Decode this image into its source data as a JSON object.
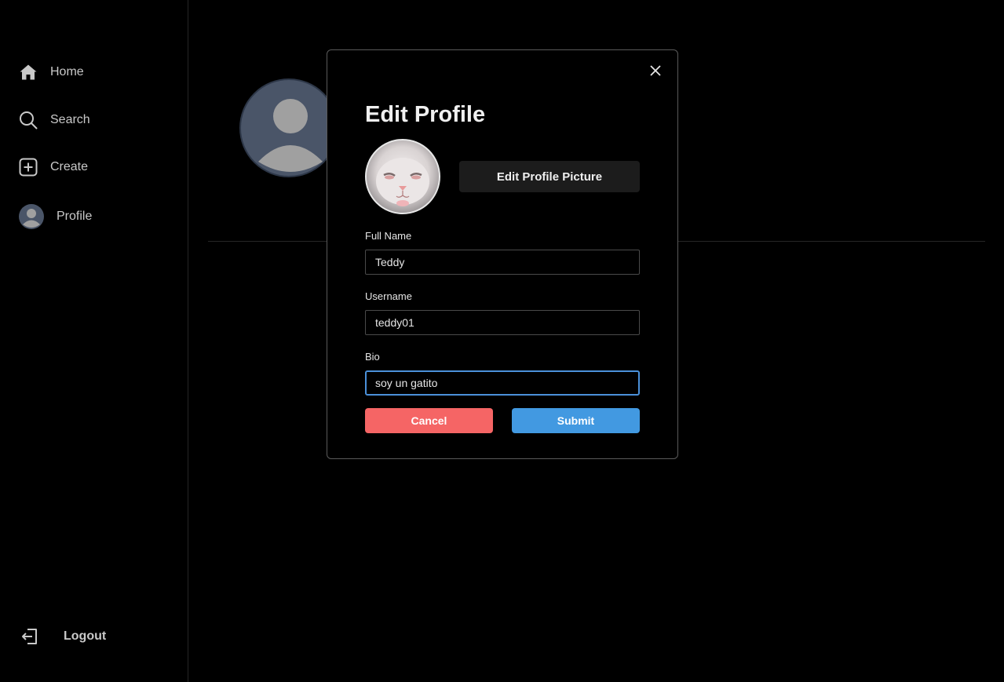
{
  "sidebar": {
    "items": [
      {
        "label": "Home",
        "icon": "home-icon"
      },
      {
        "label": "Search",
        "icon": "search-icon"
      },
      {
        "label": "Create",
        "icon": "plus-square-icon"
      },
      {
        "label": "Profile",
        "icon": "avatar"
      }
    ],
    "logout": {
      "label": "Logout",
      "icon": "logout-icon"
    }
  },
  "modal": {
    "title": "Edit Profile",
    "edit_picture_label": "Edit Profile Picture",
    "fields": {
      "full_name": {
        "label": "Full Name",
        "value": "Teddy"
      },
      "username": {
        "label": "Username",
        "value": "teddy01"
      },
      "bio": {
        "label": "Bio",
        "value": "soy un gatito"
      }
    },
    "cancel_label": "Cancel",
    "submit_label": "Submit"
  },
  "colors": {
    "cancel": "#f56565",
    "submit": "#4299e1",
    "focus_border": "#4a90d9"
  }
}
